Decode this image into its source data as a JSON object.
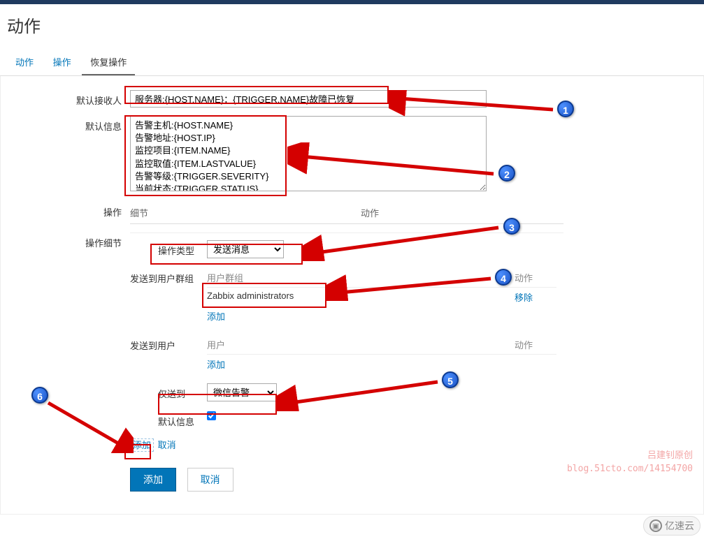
{
  "page": {
    "title": "动作"
  },
  "tabs": [
    "动作",
    "操作",
    "恢复操作"
  ],
  "active_tab": 2,
  "form": {
    "recipient_label": "默认接收人",
    "recipient_value": "服务器:{HOST.NAME}：{TRIGGER.NAME}故障已恢复",
    "message_label": "默认信息",
    "message_value": "告警主机:{HOST.NAME}\n告警地址:{HOST.IP}\n监控项目:{ITEM.NAME}\n监控取值:{ITEM.LASTVALUE}\n告警等级:{TRIGGER.SEVERITY}\n当前状态:{TRIGGER.STATUS}",
    "operations_label": "操作",
    "op_columns": {
      "detail": "细节",
      "action": "动作"
    },
    "detail_label": "操作细节",
    "op_type_label": "操作类型",
    "op_type_value": "发送消息",
    "send_group_label": "发送到用户群组",
    "group_head": "用户群组",
    "action_head": "动作",
    "group_row": "Zabbix administrators",
    "remove": "移除",
    "add_link": "添加",
    "send_user_label": "发送到用户",
    "user_head": "用户",
    "only_to_label": "仅送到",
    "only_to_value": "微信告警",
    "default_msg_label": "默认信息",
    "default_msg_checked": true,
    "inline_add": "添加",
    "inline_cancel": "取消",
    "submit_add": "添加",
    "submit_cancel": "取消"
  },
  "callouts": [
    "1",
    "2",
    "3",
    "4",
    "5",
    "6"
  ],
  "watermark": {
    "line1": "吕建钊原创",
    "line2": "blog.51cto.com/14154700"
  },
  "footer": "亿速云"
}
